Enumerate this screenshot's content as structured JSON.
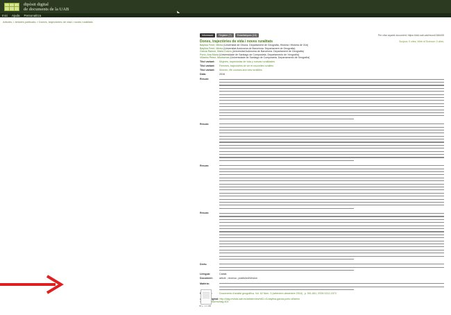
{
  "header": {
    "brand_line1": "dipòsit digital",
    "brand_line2": "de documents de la UAB"
  },
  "nav": [
    "Inici",
    "Ajuda",
    "Personalitza"
  ],
  "breadcrumb": "Articles > Articles publicats > Dones, trajectòries de vida i noves ruralitats",
  "tabs": {
    "items": [
      "Informació",
      "Registre (7)",
      "Estadístiques (16)"
    ],
    "share": "Per citar aquest document: https://ddd.uab.cat/record/186405"
  },
  "record": {
    "title": "Dones, trajectòries de vida i noves ruralitats",
    "metrics": "Scopus: 0 cites, Web of Science: 0 cites,",
    "authors": [
      {
        "name": "Baylina Ferré, Mireia",
        "aff": "(Universitat de Girona. Departament de Geografia, Història i Història de l'Art)"
      },
      {
        "name": "Baylina Ferré, Mireia",
        "aff": "(Universitat Autònoma de Barcelona. Departament de Geografia)"
      },
      {
        "name": "Garcia Ramon, Maria Dolors",
        "aff": "(Universitat Autònoma de Barcelona. Departament de Geografia)"
      },
      {
        "name": "Porto, Ana María",
        "aff": "(Universidade de Santiago de Compostela. Departamento de Xeografía)"
      },
      {
        "name": "Villarino Pérez, Montserrat",
        "aff": "(Universidade de Santiago de Compostela. Departamento de Xeografía)"
      }
    ],
    "fields": [
      {
        "k": "Títol variant:",
        "v": "Mujeres, trayectorias de vida y nuevas ruralidades"
      },
      {
        "k": "Títol variant:",
        "v": "Femmes, trajectoires de vie et nouvelles ruralités"
      },
      {
        "k": "Títol variant:",
        "v": "Women, life courses and new ruralities"
      },
      {
        "k": "Data:",
        "v": "2016"
      }
    ],
    "abstract_label": "Resum:",
    "abstract_lines": [
      14,
      13,
      15,
      16
    ],
    "rights_label": "Drets:",
    "rights_lines": 3,
    "language_label": "Llengua:",
    "language": "Català",
    "doc_label": "Document:",
    "doc": "article ; recerca ; publishedVersion",
    "subject_label": "Matèria:",
    "subject_lines": 3,
    "published_label": "Publicat a:",
    "published": "Documents d'anàlisi geogràfica, Vol. 62 Núm. 3 (setembre-desembre 2016) , p. 591-661, ISSN 0212-1573",
    "original_label": "Adreça original:",
    "original": "http://dag.revista.uab.es/article/view/v62-n3-baylina-garcia-porto-villarino",
    "doi": "DOI: 10.5565/rev/dag.403",
    "pdf_caption": "55 p. 1.1 MB"
  }
}
